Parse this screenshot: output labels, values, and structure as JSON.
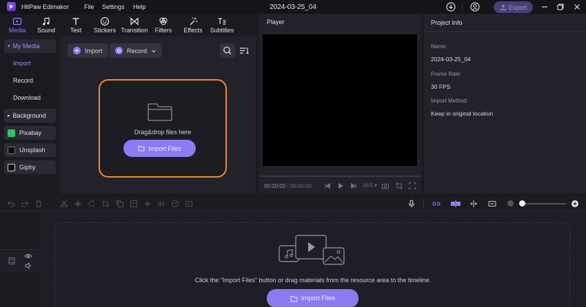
{
  "app": {
    "name": "HitPaw Edimakor",
    "menu": [
      "File",
      "Settings",
      "Help"
    ],
    "project_title": "2024-03-25_04",
    "export_label": "Export",
    "accent": "#8a7cf0",
    "highlight": "#f58a2e"
  },
  "tabs": [
    {
      "label": "Media",
      "icon": "media-icon",
      "active": true
    },
    {
      "label": "Sound",
      "icon": "music-note-icon"
    },
    {
      "label": "Text",
      "icon": "text-icon"
    },
    {
      "label": "Stickers",
      "icon": "sticker-icon"
    },
    {
      "label": "Transition",
      "icon": "transition-icon"
    },
    {
      "label": "Filters",
      "icon": "filter-icon"
    },
    {
      "label": "Effects",
      "icon": "effects-icon"
    },
    {
      "label": "Subtitles",
      "icon": "subtitles-icon"
    }
  ],
  "sidebar": {
    "my_media": "My Media",
    "items": [
      "Import",
      "Record",
      "Download"
    ],
    "background": "Background",
    "sources": [
      "Pixabay",
      "Unsplash",
      "Giphy"
    ]
  },
  "media": {
    "import_label": "Import",
    "record_label": "Record",
    "drop_text": "Drag&drop files here",
    "import_files_label": "Import Files"
  },
  "player": {
    "title": "Player",
    "time_current": "00:00:00",
    "time_total": "00:00:00",
    "ratio": "16:9"
  },
  "project_info": {
    "title": "Project Info",
    "name_label": "Name:",
    "name_value": "2024-03-25_04",
    "frame_rate_label": "Frame Rate:",
    "frame_rate_value": "30 FPS",
    "import_method_label": "Import Method:",
    "import_method_value": "Keep in original location"
  },
  "timeline": {
    "hint": "Click the \"Import Files\" button or drag materials from the resource area to the timeline.",
    "import_files_label": "Import Files"
  }
}
